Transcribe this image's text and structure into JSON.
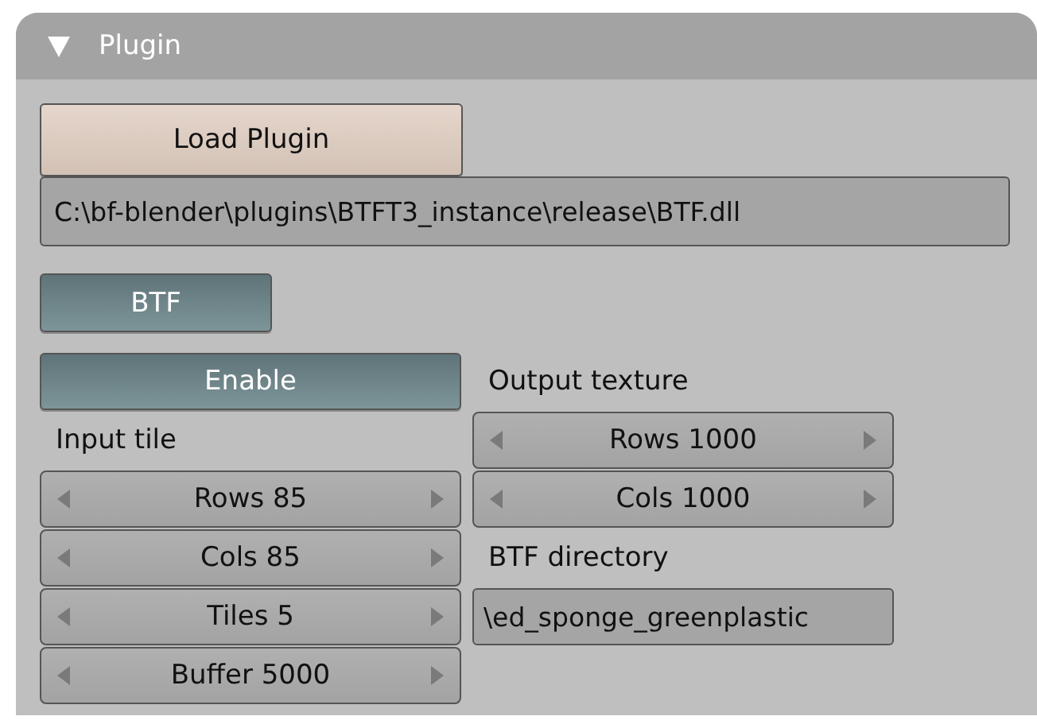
{
  "panel": {
    "title": "Plugin",
    "expanded": true
  },
  "load_button": {
    "label": "Load Plugin"
  },
  "plugin_path": {
    "value": "C:\\bf-blender\\plugins\\BTFT3_instance\\release\\BTF.dll"
  },
  "btf_toggle": {
    "label": "BTF",
    "on": true
  },
  "enable_toggle": {
    "label": "Enable",
    "on": true
  },
  "input_tile": {
    "label": "Input tile",
    "fields": [
      {
        "label": "Rows 85"
      },
      {
        "label": "Cols 85"
      },
      {
        "label": "Tiles 5"
      },
      {
        "label": "Buffer 5000"
      }
    ]
  },
  "output_texture": {
    "label": "Output texture",
    "fields": [
      {
        "label": "Rows 1000"
      },
      {
        "label": "Cols 1000"
      }
    ]
  },
  "btf_directory": {
    "label": "BTF directory",
    "value": "\\ed_sponge_greenplastic"
  }
}
